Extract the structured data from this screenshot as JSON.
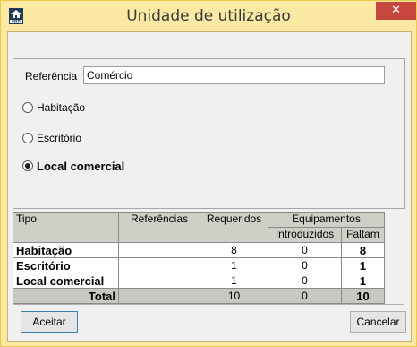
{
  "window": {
    "title": "Unidade de utilização",
    "close_glyph": "✕",
    "app_icon": "mep-house-icon"
  },
  "form": {
    "reference_label": "Referência",
    "reference_value": "Comércio",
    "options": [
      {
        "label": "Habitação",
        "checked": false
      },
      {
        "label": "Escritório",
        "checked": false
      },
      {
        "label": "Local comercial",
        "checked": true
      }
    ]
  },
  "table": {
    "headers": {
      "tipo": "Tipo",
      "referencias": "Referências",
      "requeridos": "Requeridos",
      "equipamentos": "Equipamentos",
      "introduzidos": "Introduzidos",
      "faltam": "Faltam"
    },
    "rows": [
      {
        "tipo": "Habitação",
        "referencias": "",
        "requeridos": "8",
        "introduzidos": "0",
        "faltam": "8"
      },
      {
        "tipo": "Escritório",
        "referencias": "",
        "requeridos": "1",
        "introduzidos": "0",
        "faltam": "1"
      },
      {
        "tipo": "Local comercial",
        "referencias": "",
        "requeridos": "1",
        "introduzidos": "0",
        "faltam": "1"
      }
    ],
    "total": {
      "label": "Total",
      "requeridos": "10",
      "introduzidos": "0",
      "faltam": "10"
    }
  },
  "buttons": {
    "ok": "Aceitar",
    "cancel": "Cancelar"
  },
  "colors": {
    "titlebar": "#fce9a3",
    "close": "#c7463d",
    "panel": "#f0f0f0"
  }
}
